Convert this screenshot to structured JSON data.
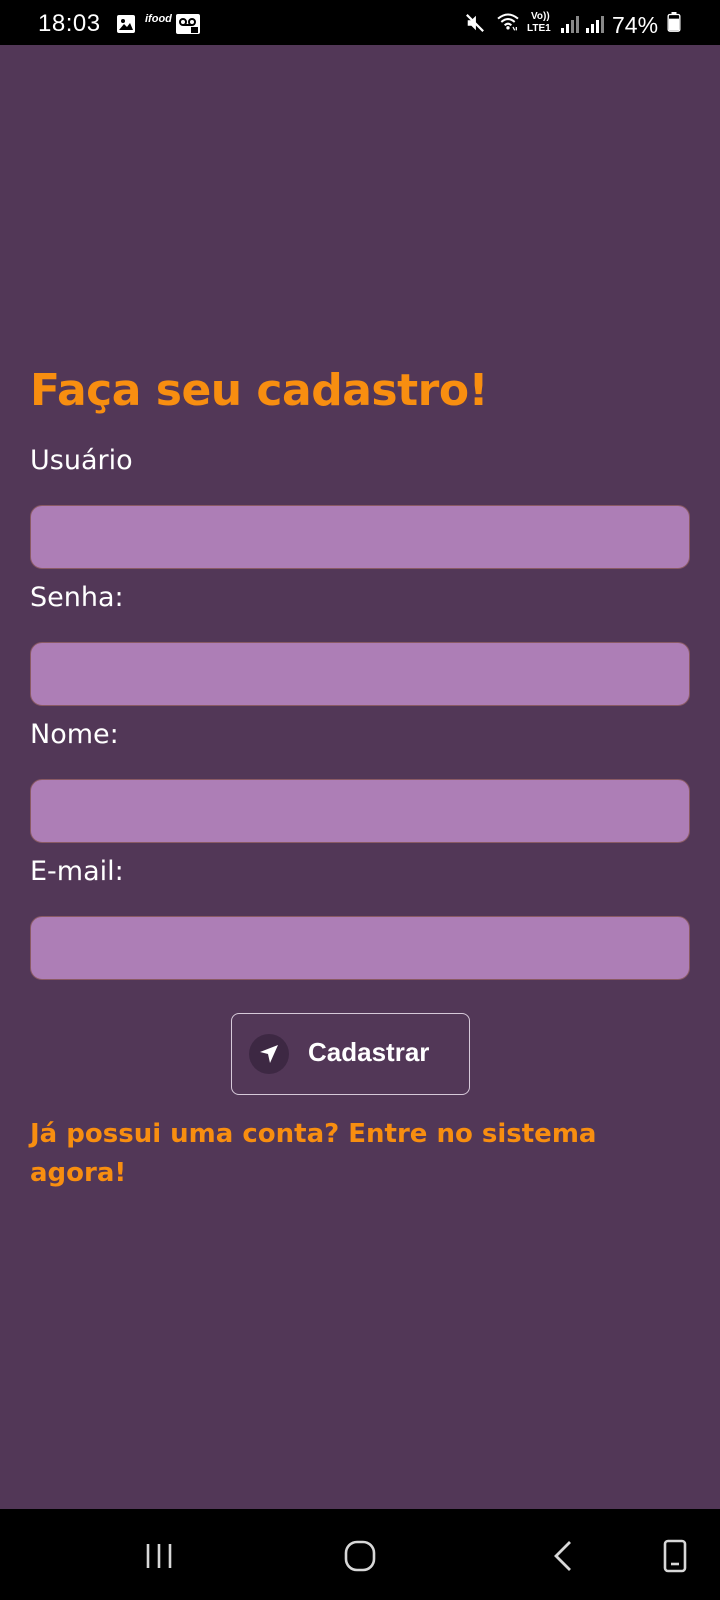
{
  "status_bar": {
    "time": "18:03",
    "app_icon_label": "ifood",
    "network_label_top": "Vo))",
    "network_label_bottom": "LTE1",
    "battery_percent": "74%",
    "icons": [
      "image-icon",
      "ifood-icon",
      "voicemail-icon",
      "mute-icon",
      "wifi-icon",
      "signal-icon",
      "signal-icon",
      "battery-icon"
    ]
  },
  "form": {
    "title": "Faça seu cadastro!",
    "fields": [
      {
        "label": "Usuário",
        "value": ""
      },
      {
        "label": "Senha:",
        "value": ""
      },
      {
        "label": "Nome:",
        "value": ""
      },
      {
        "label": "E-mail:",
        "value": ""
      }
    ],
    "submit_label": "Cadastrar",
    "submit_icon": "navigation-arrow-icon",
    "login_link": "Já possui uma conta? Entre no sistema agora!"
  },
  "nav_bar": {
    "buttons": [
      "recent-apps-icon",
      "home-icon",
      "back-icon",
      "rotate-screen-icon"
    ]
  },
  "colors": {
    "background": "#523757",
    "accent": "#f88e10",
    "input_fill": "#ad7eb6",
    "text": "#ffffff"
  }
}
